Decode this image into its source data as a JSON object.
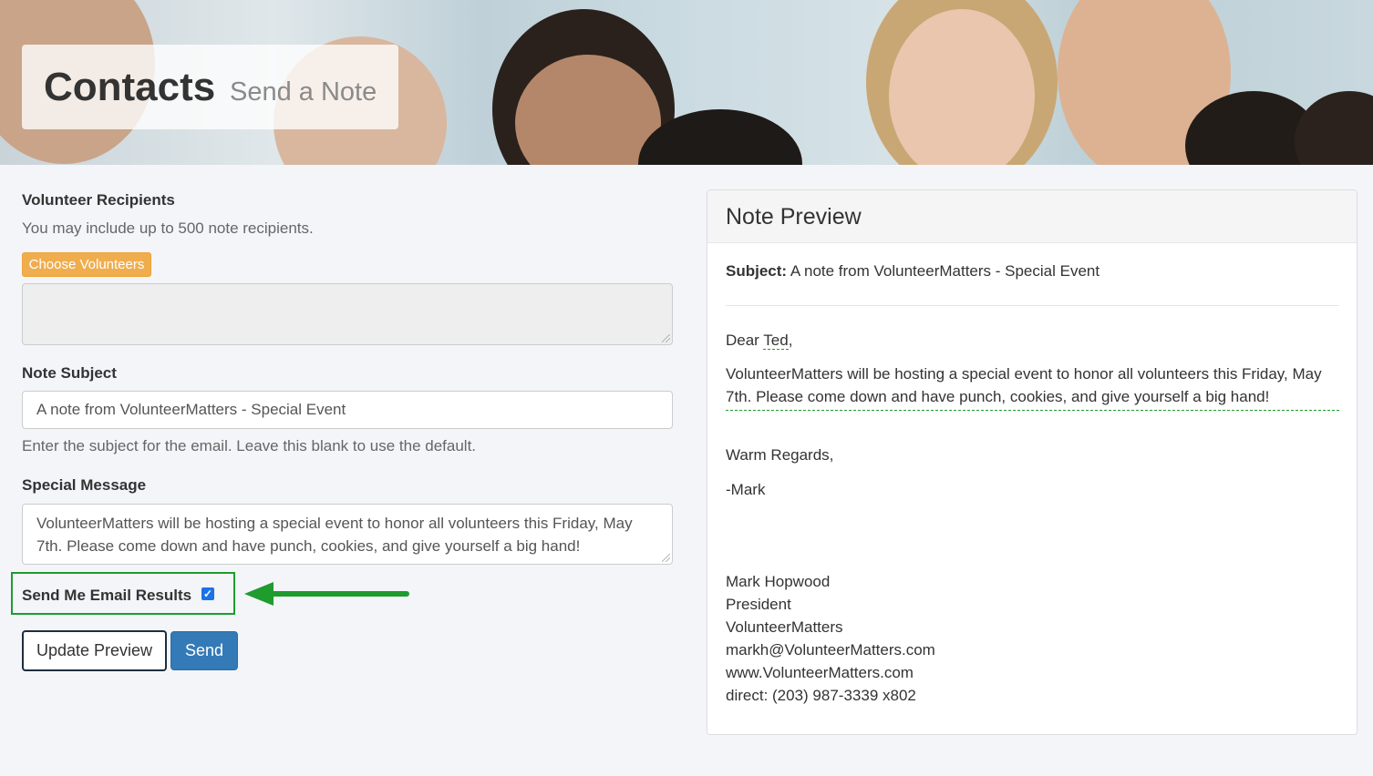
{
  "header": {
    "title": "Contacts",
    "subtitle": "Send a Note"
  },
  "form": {
    "recipients_label": "Volunteer Recipients",
    "recipients_help": "You may include up to 500 note recipients.",
    "choose_button": "Choose Volunteers",
    "subject_label": "Note Subject",
    "subject_value": "A note from VolunteerMatters - Special Event",
    "subject_help": "Enter the subject for the email. Leave this blank to use the default.",
    "message_label": "Special Message",
    "message_value": "VolunteerMatters will be hosting a special event to honor all volunteers this Friday, May 7th. Please come down and have punch, cookies, and give yourself a big hand!",
    "email_results_label": "Send Me Email Results",
    "email_results_checked": true,
    "update_button": "Update Preview",
    "send_button": "Send"
  },
  "preview": {
    "title": "Note Preview",
    "subject_label": "Subject:",
    "subject_value": "A note from VolunteerMatters - Special Event",
    "greeting_prefix": "Dear",
    "greeting_name": "Ted",
    "greeting_suffix": ",",
    "message": "VolunteerMatters will be hosting a special event to honor all volunteers this Friday, May 7th. Please come down and have punch, cookies, and give yourself a big hand!",
    "closing": "Warm Regards,",
    "sender_short": "-Mark",
    "signature": {
      "name": "Mark Hopwood",
      "title": "President",
      "org": "VolunteerMatters",
      "email": "markh@VolunteerMatters.com",
      "website": "www.VolunteerMatters.com",
      "phone": "direct: (203) 987-3339 x802"
    }
  },
  "colors": {
    "accent_orange": "#f0ad4e",
    "primary_blue": "#337ab7",
    "highlight_green": "#1e9c2e"
  }
}
